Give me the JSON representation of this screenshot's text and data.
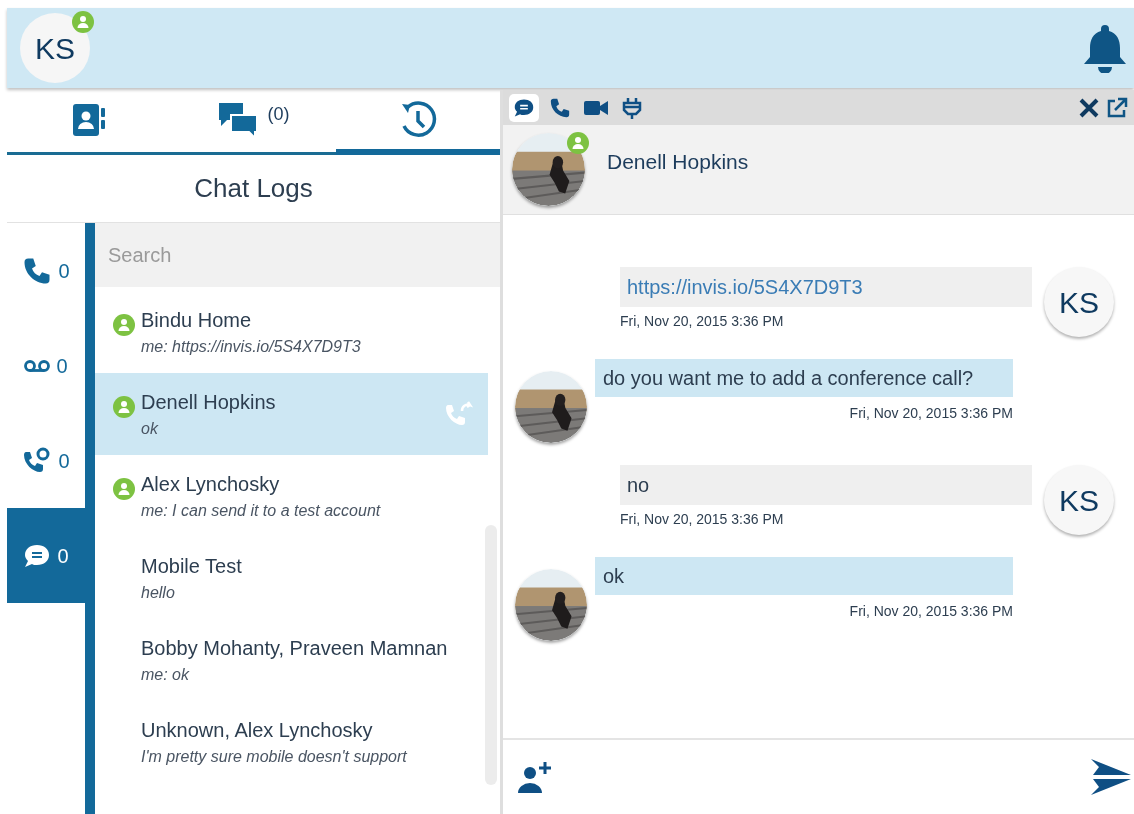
{
  "header": {
    "user_initials": "KS",
    "online": true
  },
  "nav_tabs": [
    {
      "kind": "contacts",
      "selected": false
    },
    {
      "kind": "chats",
      "count": "(0)",
      "selected": false
    },
    {
      "kind": "history",
      "selected": true
    }
  ],
  "panel_title": "Chat Logs",
  "rail": [
    {
      "kind": "phone",
      "count": "0",
      "selected": false
    },
    {
      "kind": "voicemail",
      "count": "0",
      "selected": false
    },
    {
      "kind": "missed",
      "count": "0",
      "selected": false
    },
    {
      "kind": "chat",
      "count": "0",
      "selected": true
    }
  ],
  "search": {
    "placeholder": "Search"
  },
  "conversations": [
    {
      "name": "Bindu Home",
      "preview": "me: https://invis.io/5S4X7D9T3",
      "online": true,
      "selected": false
    },
    {
      "name": "Denell Hopkins",
      "preview": "ok",
      "online": true,
      "selected": true
    },
    {
      "name": "Alex Lynchosky",
      "preview": "me: I can send it to a test account",
      "online": true,
      "selected": false
    },
    {
      "name": "Mobile Test",
      "preview": "hello",
      "online": false,
      "selected": false
    },
    {
      "name": "Bobby Mohanty, Praveen Mamnan",
      "preview": "me: ok",
      "online": false,
      "selected": false
    },
    {
      "name": "Unknown, Alex Lynchosky",
      "preview": "I'm pretty sure mobile doesn't support",
      "online": false,
      "selected": false
    }
  ],
  "chat": {
    "toolbar": [
      {
        "kind": "chat",
        "selected": true
      },
      {
        "kind": "phone",
        "selected": false
      },
      {
        "kind": "video",
        "selected": false
      },
      {
        "kind": "plug",
        "selected": false
      }
    ],
    "contact": {
      "name": "Denell Hopkins",
      "online": true
    },
    "messages": [
      {
        "kind": "outgoing",
        "text": "https://invis.io/5S4X7D9T3",
        "link": true,
        "initials": "KS",
        "time": "Fri, Nov 20, 2015 3:36 PM"
      },
      {
        "kind": "incoming",
        "text": "do you want me to add a conference call?",
        "link": false,
        "time": "Fri, Nov 20, 2015 3:36 PM"
      },
      {
        "kind": "outgoing",
        "text": "no",
        "link": false,
        "initials": "KS",
        "time": "Fri, Nov 20, 2015 3:36 PM"
      },
      {
        "kind": "incoming",
        "text": "ok",
        "link": false,
        "time": "Fri, Nov 20, 2015 3:36 PM"
      }
    ]
  }
}
